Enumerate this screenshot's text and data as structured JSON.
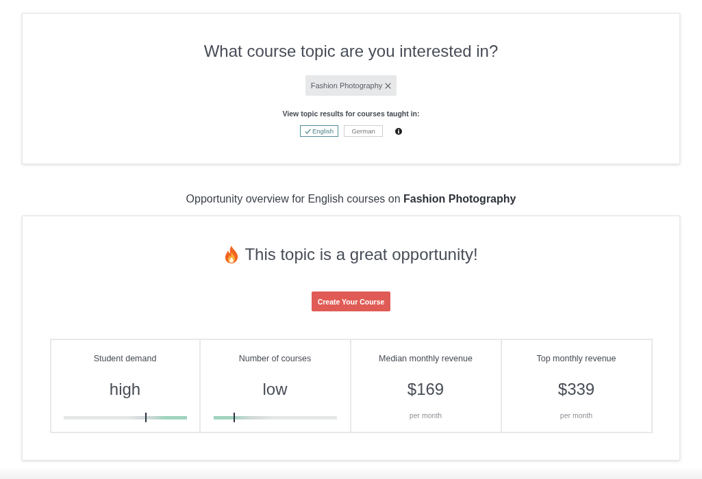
{
  "topic_card": {
    "title": "What course topic are you interested in?",
    "selected_topic": {
      "label": "Fashion Photography"
    },
    "language_prompt": "View topic results for courses taught in:",
    "languages": [
      {
        "label": "English",
        "selected": true
      },
      {
        "label": "German",
        "selected": false
      }
    ]
  },
  "overview_heading": "Opportunity overview for English courses on **Fashion Photography**",
  "opportunity_card": {
    "title": "This topic is a great opportunity!",
    "button": "Create Your Course",
    "metrics": [
      {
        "kind": "meter",
        "label": "Student demand",
        "value": "high",
        "level": 0.67,
        "favorable_high": true
      },
      {
        "kind": "meter",
        "label": "Number of courses",
        "value": "low",
        "level": 0.17,
        "favorable_high": false
      },
      {
        "kind": "amount",
        "label": "Median monthly revenue",
        "value": "$169",
        "unit": "per month"
      },
      {
        "kind": "amount",
        "label": "Top monthly revenue",
        "value": "$339",
        "unit": "per month"
      }
    ]
  }
}
